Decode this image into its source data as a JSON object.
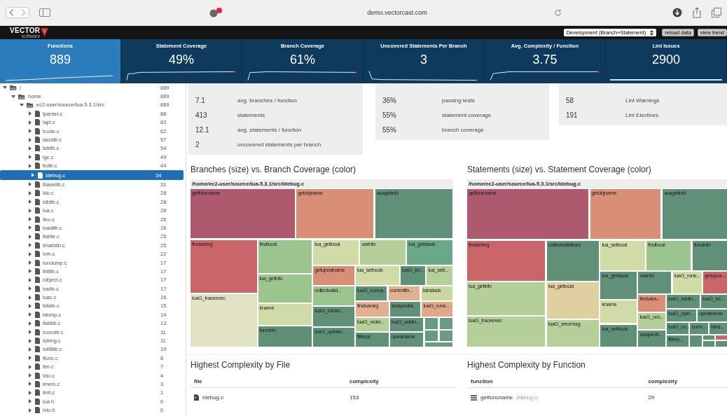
{
  "browser": {
    "url": "demo.vectorcast.com"
  },
  "header": {
    "logo": "VECTOR",
    "logo_sub": "software",
    "select": "Development (Branch+Statement)",
    "buttons": [
      "reload data",
      "view trend"
    ]
  },
  "metrics": [
    {
      "label": "Functions",
      "value": "889",
      "selected": true
    },
    {
      "label": "Statement Coverage",
      "value": "49%",
      "selected": false
    },
    {
      "label": "Branch Coverage",
      "value": "61%",
      "selected": false
    },
    {
      "label": "Uncovered Statements Per Branch",
      "value": "3",
      "selected": false
    },
    {
      "label": "Avg. Complexity / Function",
      "value": "3.75",
      "selected": false
    },
    {
      "label": "Lint Issues",
      "value": "2900",
      "selected": false
    }
  ],
  "tree": [
    {
      "kind": "folder",
      "label": "/",
      "count": "889",
      "expanded": true,
      "selected": false,
      "children": [
        {
          "kind": "folder",
          "label": "home",
          "count": "889",
          "expanded": true,
          "selected": false,
          "children": [
            {
              "kind": "folder",
              "label": "ec2-user/source/lua-5.3.1/src",
              "count": "889",
              "expanded": true,
              "selected": false,
              "children": [
                {
                  "kind": "file",
                  "label": "lparser.c",
                  "count": "86",
                  "expanded": false,
                  "selected": false
                },
                {
                  "kind": "file",
                  "label": "lapi.c",
                  "count": "83",
                  "expanded": false,
                  "selected": false
                },
                {
                  "kind": "file",
                  "label": "lcode.c",
                  "count": "62",
                  "expanded": false,
                  "selected": false
                },
                {
                  "kind": "file",
                  "label": "lauxlib.c",
                  "count": "57",
                  "expanded": false,
                  "selected": false
                },
                {
                  "kind": "file",
                  "label": "lstrlib.c",
                  "count": "54",
                  "expanded": false,
                  "selected": false
                },
                {
                  "kind": "file",
                  "label": "lgc.c",
                  "count": "49",
                  "expanded": false,
                  "selected": false
                },
                {
                  "kind": "file",
                  "label": "liolib.c",
                  "count": "44",
                  "expanded": false,
                  "selected": false
                },
                {
                  "kind": "file",
                  "label": "ldebug.c",
                  "count": "34",
                  "expanded": false,
                  "selected": true
                },
                {
                  "kind": "file",
                  "label": "lbaselib.c",
                  "count": "31",
                  "expanded": false,
                  "selected": false
                },
                {
                  "kind": "file",
                  "label": "ldo.c",
                  "count": "28",
                  "expanded": false,
                  "selected": false
                },
                {
                  "kind": "file",
                  "label": "ldblib.c",
                  "count": "28",
                  "expanded": false,
                  "selected": false
                },
                {
                  "kind": "file",
                  "label": "lua.c",
                  "count": "28",
                  "expanded": false,
                  "selected": false
                },
                {
                  "kind": "file",
                  "label": "llex.c",
                  "count": "26",
                  "expanded": false,
                  "selected": false
                },
                {
                  "kind": "file",
                  "label": "loadlib.c",
                  "count": "26",
                  "expanded": false,
                  "selected": false
                },
                {
                  "kind": "file",
                  "label": "ltable.c",
                  "count": "25",
                  "expanded": false,
                  "selected": false
                },
                {
                  "kind": "file",
                  "label": "lmathlib.c",
                  "count": "25",
                  "expanded": false,
                  "selected": false
                },
                {
                  "kind": "file",
                  "label": "lvm.c",
                  "count": "22",
                  "expanded": false,
                  "selected": false
                },
                {
                  "kind": "file",
                  "label": "lundump.c",
                  "count": "17",
                  "expanded": false,
                  "selected": false
                },
                {
                  "kind": "file",
                  "label": "lbitlib.c",
                  "count": "17",
                  "expanded": false,
                  "selected": false
                },
                {
                  "kind": "file",
                  "label": "lobject.c",
                  "count": "17",
                  "expanded": false,
                  "selected": false
                },
                {
                  "kind": "file",
                  "label": "loslib.c",
                  "count": "17",
                  "expanded": false,
                  "selected": false
                },
                {
                  "kind": "file",
                  "label": "luac.c",
                  "count": "16",
                  "expanded": false,
                  "selected": false
                },
                {
                  "kind": "file",
                  "label": "lstate.c",
                  "count": "15",
                  "expanded": false,
                  "selected": false
                },
                {
                  "kind": "file",
                  "label": "ldump.c",
                  "count": "14",
                  "expanded": false,
                  "selected": false
                },
                {
                  "kind": "file",
                  "label": "ltablib.c",
                  "count": "13",
                  "expanded": false,
                  "selected": false
                },
                {
                  "kind": "file",
                  "label": "lcorolib.c",
                  "count": "11",
                  "expanded": false,
                  "selected": false
                },
                {
                  "kind": "file",
                  "label": "lstring.c",
                  "count": "11",
                  "expanded": false,
                  "selected": false
                },
                {
                  "kind": "file",
                  "label": "lutf8lib.c",
                  "count": "10",
                  "expanded": false,
                  "selected": false
                },
                {
                  "kind": "file",
                  "label": "lfunc.c",
                  "count": "8",
                  "expanded": false,
                  "selected": false
                },
                {
                  "kind": "file",
                  "label": "ltm.c",
                  "count": "7",
                  "expanded": false,
                  "selected": false
                },
                {
                  "kind": "file",
                  "label": "lzio.c",
                  "count": "4",
                  "expanded": false,
                  "selected": false
                },
                {
                  "kind": "file",
                  "label": "lmem.c",
                  "count": "3",
                  "expanded": false,
                  "selected": false
                },
                {
                  "kind": "file",
                  "label": "linit.c",
                  "count": "1",
                  "expanded": false,
                  "selected": false
                },
                {
                  "kind": "file",
                  "label": "lua.h",
                  "count": "0",
                  "expanded": false,
                  "selected": false
                },
                {
                  "kind": "file",
                  "label": "lzio.h",
                  "count": "0",
                  "expanded": false,
                  "selected": false
                }
              ]
            }
          ]
        }
      ]
    }
  ],
  "stats": [
    {
      "rows": [
        {
          "value": "7.1",
          "label": "avg. branches / function"
        },
        {
          "value": "413",
          "label": "statements"
        },
        {
          "value": "12.1",
          "label": "avg. statements / function"
        },
        {
          "value": "2",
          "label": "uncovered statements per branch"
        }
      ]
    },
    {
      "rows": [
        {
          "value": "36%",
          "label": "passing tests"
        },
        {
          "value": "55%",
          "label": "statement coverage"
        },
        {
          "value": "55%",
          "label": "branch coverage"
        }
      ]
    },
    {
      "rows": [
        {
          "value": "58",
          "label": "Lint Warnings"
        },
        {
          "value": "191",
          "label": "Lint Electives"
        }
      ]
    }
  ],
  "treemaps": [
    {
      "title": "Branches (size) vs. Branch Coverage (color)",
      "path": "/home/ec2-user/source/lua-5.3.1/src/ldebug.c",
      "tiles": [
        {
          "label": "getfuncname",
          "color": "#ad5a6e"
        },
        {
          "label": "getobjname",
          "color": "#d98f76"
        },
        {
          "label": "auxgetinfo",
          "color": "#5f9179"
        },
        {
          "label": "findsetreg",
          "color": "#c8666a"
        },
        {
          "label": "luaG_traceexec",
          "color": "#e2e2c4"
        },
        {
          "label": "findlocal",
          "color": "#9cc48f"
        },
        {
          "label": "lua_getinfo",
          "color": "#9cc48f"
        },
        {
          "label": "kname",
          "color": "#cfdca8"
        },
        {
          "label": "funcinfo",
          "color": "#5f9179"
        },
        {
          "label": "lua_getlocal",
          "color": "#d1dba8"
        },
        {
          "label": "varinfo",
          "color": "#b5cf99"
        },
        {
          "label": "lua_getstack",
          "color": "#6aa888"
        },
        {
          "label": "getupvalname",
          "color": "#d98f76"
        },
        {
          "label": "lua_sethook",
          "color": "#d1dba8"
        },
        {
          "label": "luaG_err...",
          "color": "#5f9179"
        },
        {
          "label": "lua_setl...",
          "color": "#b5cf99"
        },
        {
          "label": "collectvalid...",
          "color": "#9cc48f"
        },
        {
          "label": "luaG_tointer...",
          "color": "#5f9179"
        },
        {
          "label": "luaG_opinter...",
          "color": "#5f9179"
        },
        {
          "label": "luaG_conca...",
          "color": "#5f9179"
        },
        {
          "label": "currentlin...",
          "color": "#e0b090"
        },
        {
          "label": "isinstack",
          "color": "#c5d9a0"
        },
        {
          "label": "findvararg",
          "color": "#e0b090"
        },
        {
          "label": "swapextra",
          "color": "#5f9179"
        },
        {
          "label": "luaG_rune...",
          "color": "#e0a888"
        },
        {
          "label": "luaG_order...",
          "color": "#b5cf99"
        },
        {
          "label": "luaG_addin...",
          "color": "#5f9179"
        },
        {
          "label": "filterpc",
          "color": "#5f9179"
        },
        {
          "label": "upvalname",
          "color": "#5f9179"
        },
        {
          "color": "#6a9a80"
        },
        {
          "color": "#6a9a80"
        },
        {
          "color": "#6a9a80"
        },
        {
          "color": "#6a9a80"
        },
        {
          "color": "#6a9a80"
        }
      ]
    },
    {
      "title": "Statements (size) vs. Statement Coverage (color)",
      "path": "/home/ec2-user/source/lua-5.3.1/src/ldebug.c",
      "tiles": [
        {
          "label": "getfuncname",
          "color": "#ad5a6e"
        },
        {
          "label": "getobjname",
          "color": "#d98f76"
        },
        {
          "label": "auxgetinfo",
          "color": "#5f9179"
        },
        {
          "label": "findsetreg",
          "color": "#c8666a"
        },
        {
          "label": "lua_getinfo",
          "color": "#b5cf99"
        },
        {
          "label": "luaG_traceexec",
          "color": "#b5cf99"
        },
        {
          "label": "collectvalidlines",
          "color": "#5f9179"
        },
        {
          "label": "lua_getlocal",
          "color": "#e0cfa0"
        },
        {
          "label": "luaG_errormsg",
          "color": "#b5cf99"
        },
        {
          "label": "lua_setlocal",
          "color": "#d1dba8"
        },
        {
          "label": "findlocal",
          "color": "#9cc48f"
        },
        {
          "label": "funcinfo",
          "color": "#5f9179"
        },
        {
          "label": "lua_getstack",
          "color": "#5f9179"
        },
        {
          "label": "kname",
          "color": "#d1dba8"
        },
        {
          "label": "lua_sethook",
          "color": "#5f9179"
        },
        {
          "label": "varinfo",
          "color": "#5f9179"
        },
        {
          "label": "luaG_rune...",
          "color": "#d1dba8"
        },
        {
          "label": "getupva...",
          "color": "#c8666a"
        },
        {
          "label": "findvara...",
          "color": "#d98f76"
        },
        {
          "label": "luaG_ord...",
          "color": "#b5cf99"
        },
        {
          "label": "swapextr...",
          "color": "#5f9179"
        },
        {
          "label": "luaG_addin...",
          "color": "#5f9179"
        },
        {
          "label": "luaG_toi...",
          "color": "#5f9179"
        },
        {
          "label": "luaG_opin...",
          "color": "#5f9179"
        },
        {
          "label": "upvalname",
          "color": "#5f9179"
        },
        {
          "label": "luaG_co...",
          "color": "#5f9179"
        },
        {
          "label": "curre...",
          "color": "#5f9179"
        },
        {
          "label": "isins...",
          "color": "#5f9179"
        },
        {
          "label": "filterp...",
          "color": "#5f9179"
        },
        {
          "color": "#5f9179"
        },
        {
          "color": "#5f9179"
        },
        {
          "color": "#c8666a"
        },
        {
          "color": "#5f9179"
        },
        {
          "color": "#5f9179"
        }
      ]
    }
  ],
  "tables": [
    {
      "title": "Highest Complexity by File",
      "columns": [
        "file",
        "complexity"
      ],
      "rows": [
        {
          "kind": "file",
          "name": "ldebug.c",
          "value": "153"
        }
      ]
    },
    {
      "title": "Highest Complexity by Function",
      "columns": [
        "function",
        "complexity"
      ],
      "rows": [
        {
          "kind": "function",
          "name": "getfuncname",
          "note": "(ldebug.c)",
          "value": "29"
        }
      ]
    }
  ]
}
